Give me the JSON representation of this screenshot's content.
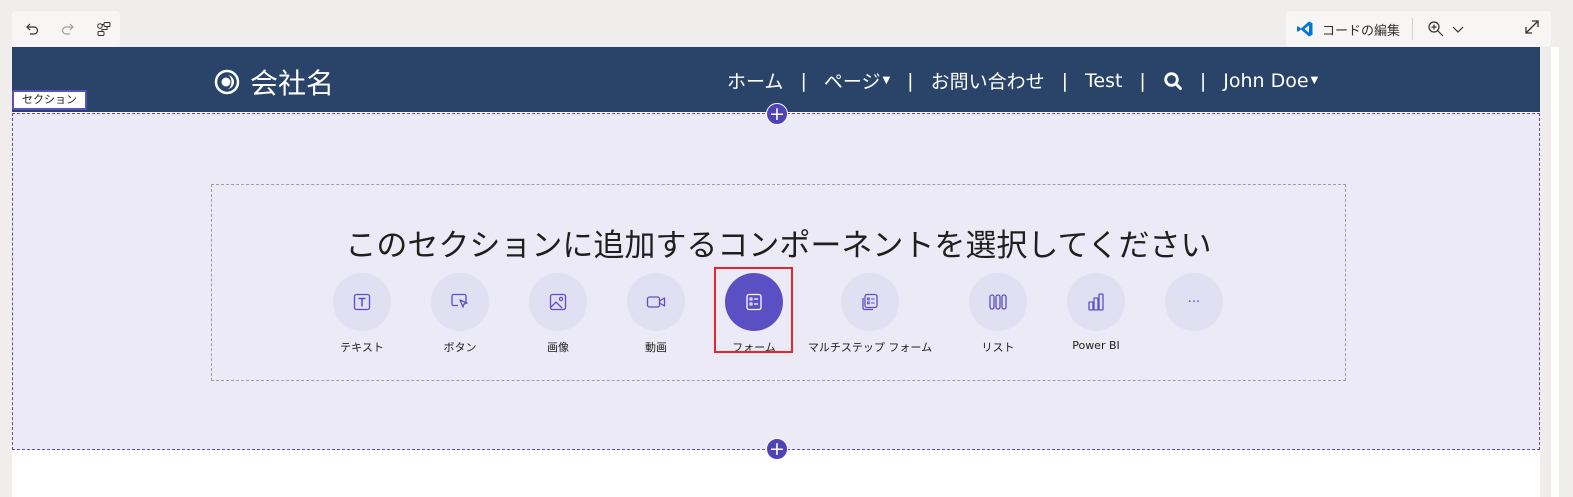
{
  "toolbar": {
    "undo_icon": "undo-icon",
    "redo_icon": "redo-icon",
    "sitemap_icon": "sitemap-icon",
    "code_edit_label": "コードの編集",
    "zoom_icon": "zoom-icon",
    "expand_icon": "expand-icon"
  },
  "header": {
    "brand_name": "会社名",
    "nav": [
      {
        "label": "ホーム"
      },
      {
        "label": "ページ",
        "dropdown": true
      },
      {
        "label": "お問い合わせ"
      },
      {
        "label": "Test"
      },
      {
        "label": "search-icon",
        "icon": true
      },
      {
        "label": "John Doe",
        "dropdown": true
      }
    ]
  },
  "section": {
    "tag": "セクション",
    "picker_title": "このセクションに追加するコンポーネントを選択してください",
    "components": [
      {
        "label": "テキスト",
        "icon": "text-icon"
      },
      {
        "label": "ボタン",
        "icon": "button-icon"
      },
      {
        "label": "画像",
        "icon": "image-icon"
      },
      {
        "label": "動画",
        "icon": "video-icon"
      },
      {
        "label": "フォーム",
        "icon": "form-icon",
        "selected": true
      },
      {
        "label": "マルチステップ フォーム",
        "icon": "multistep-form-icon"
      },
      {
        "label": "リスト",
        "icon": "list-icon"
      },
      {
        "label": "Power BI",
        "icon": "powerbi-icon"
      },
      {
        "label": "···",
        "icon": "more-icon"
      }
    ]
  },
  "colors": {
    "header_bg": "#294468",
    "section_bg": "#eceaf6",
    "accent": "#5b4fc4",
    "highlight": "#e4282a"
  }
}
